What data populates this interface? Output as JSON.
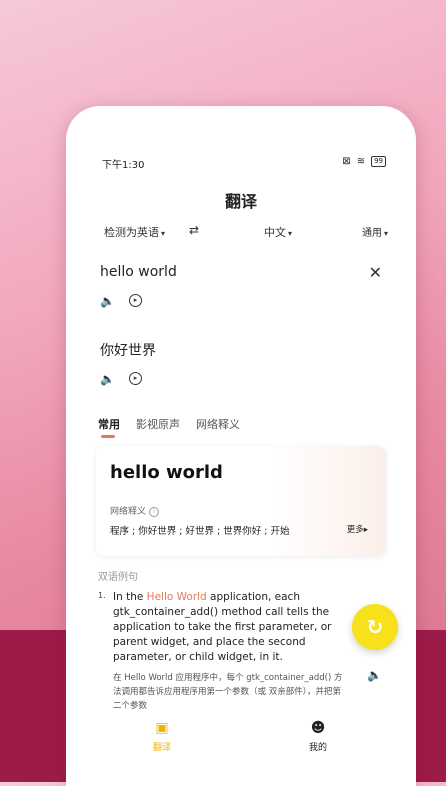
{
  "status": {
    "time": "下午1:30",
    "battery": "99"
  },
  "header": {
    "title": "翻译"
  },
  "langs": {
    "source": "检测为英语",
    "target": "中文",
    "domain": "通用"
  },
  "input": {
    "text": "hello world"
  },
  "output": {
    "text": "你好世界"
  },
  "tabs": [
    {
      "label": "常用"
    },
    {
      "label": "影视原声"
    },
    {
      "label": "网络释义"
    }
  ],
  "result": {
    "word": "hello world",
    "net_label": "网络释义",
    "meanings": "程序 ; 你好世界 ; 好世界 ; 世界你好 ; 开始",
    "more": "更多"
  },
  "examples_label": "双语例句",
  "example": {
    "num": "1.",
    "en_pre": "In the ",
    "en_hl": "Hello World",
    "en_post": " application, each gtk_container_add() method call tells the application to take the first parameter, or parent widget, and place the second parameter, or child widget, in it.",
    "zh": "在 Hello World 应用程序中，每个 gtk_container_add() 方法调用都告诉应用程序用第一个参数（或 双亲部件），并把第二个参数"
  },
  "nav": [
    {
      "label": "翻译"
    },
    {
      "label": "我的"
    }
  ],
  "colors": {
    "accent": "#e27a5a",
    "fab": "#f7e11a",
    "band": "#9d1b48"
  }
}
